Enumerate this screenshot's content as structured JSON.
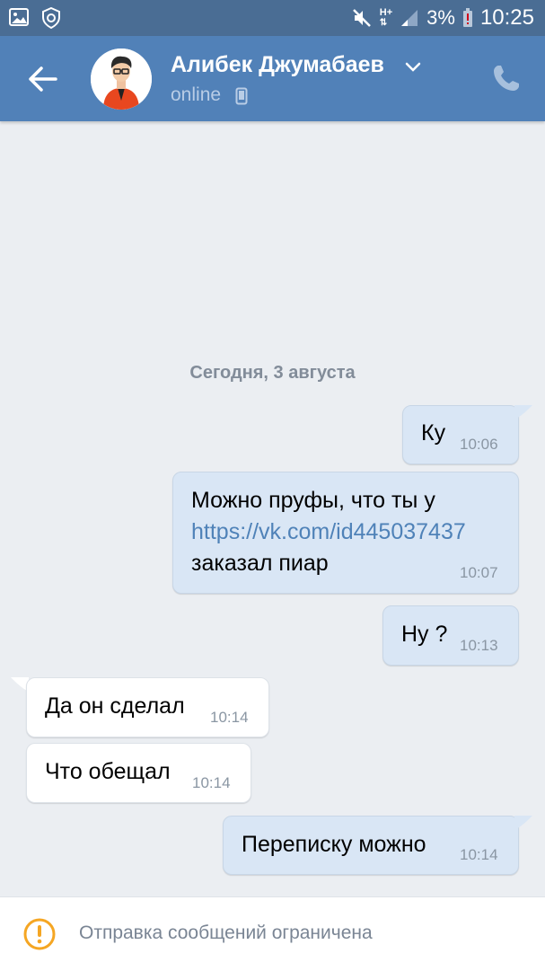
{
  "status_bar": {
    "battery_percent": "3%",
    "time": "10:25",
    "network": "H+"
  },
  "header": {
    "contact_name": "Алибек Джумабаев",
    "status": "online"
  },
  "chat": {
    "date_separator": "Сегодня, 3 августа",
    "messages": [
      {
        "direction": "out",
        "lines": [
          "Ку"
        ],
        "time": "10:06"
      },
      {
        "direction": "out",
        "lines": [
          "Можно пруфы, что ты у",
          "https://vk.com/id445037437",
          "заказал пиар"
        ],
        "time": "10:07"
      },
      {
        "direction": "out",
        "lines": [
          "Ну ?"
        ],
        "time": "10:13"
      },
      {
        "direction": "in",
        "lines": [
          "Да он сделал"
        ],
        "time": "10:14"
      },
      {
        "direction": "in",
        "lines": [
          "Что обещал"
        ],
        "time": "10:14"
      },
      {
        "direction": "out",
        "lines": [
          "Переписку можно"
        ],
        "time": "10:14"
      }
    ]
  },
  "footer": {
    "notice": "Отправка сообщений ограничена"
  },
  "colors": {
    "header": "#5181b8",
    "status_bar": "#4a6d94",
    "background": "#ebeef2",
    "outgoing_bubble": "#d9e6f5",
    "incoming_bubble": "#ffffff",
    "link": "#4f82b8",
    "warning": "#f5a623"
  }
}
